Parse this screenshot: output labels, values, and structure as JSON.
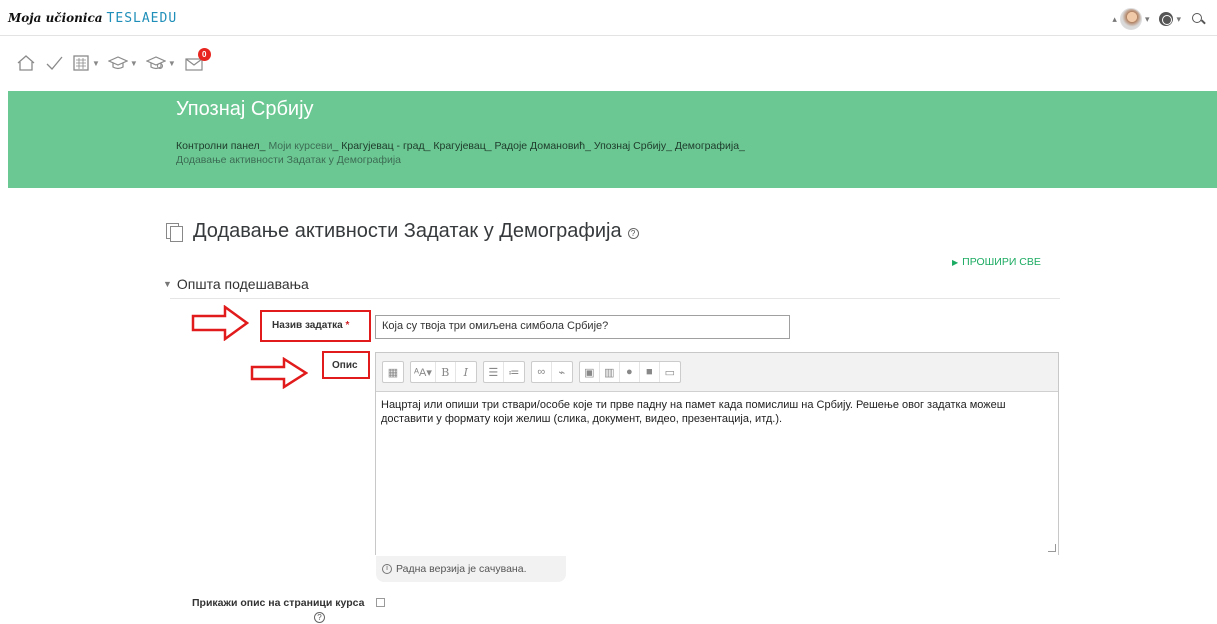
{
  "navbar": {
    "brand_script": "Moja učionica",
    "brand_tesla": "TESLAEDU"
  },
  "iconbar": {
    "items": [
      "home-icon",
      "check-icon",
      "calendar-icon",
      "graduation-cap-icon",
      "course-cap-icon",
      "mail-icon"
    ],
    "mail_badge": "0"
  },
  "header": {
    "course_title": "Упознај Србију",
    "breadcrumb": [
      "Контролни панел",
      "Моји курсеви",
      "Крагујевац - град",
      "Крагујевац",
      "Радоје Домановић",
      "Упознај Србију",
      "Демографија",
      "Додавање активности Задатак у Демографија"
    ]
  },
  "page": {
    "title": "Додавање активности Задатак у Демографија",
    "help": "?",
    "expand_all": "ПРОШИРИ СВЕ",
    "section": "Општа подешавања"
  },
  "form": {
    "name_label": "Назив задатка",
    "required_mark": "*",
    "name_value": "Која су твоја три омиљена симбола Србије?",
    "description_label": "Опис",
    "description_text": "Нацртај или опиши три ствари/особе које ти прве падну на памет када помислиш на Србију. Решење овог задатка можеш доставити у формату који желиш (слика, документ, видео, презентација, итд.).",
    "draft_saved": "Радна верзија је сачувана.",
    "show_description_label": "Прикажи опис на страници курса",
    "show_description_checked": false
  },
  "colors": {
    "header_green": "#6cc893",
    "link_green": "#1cab62",
    "annotation_red": "#e11b1b"
  }
}
